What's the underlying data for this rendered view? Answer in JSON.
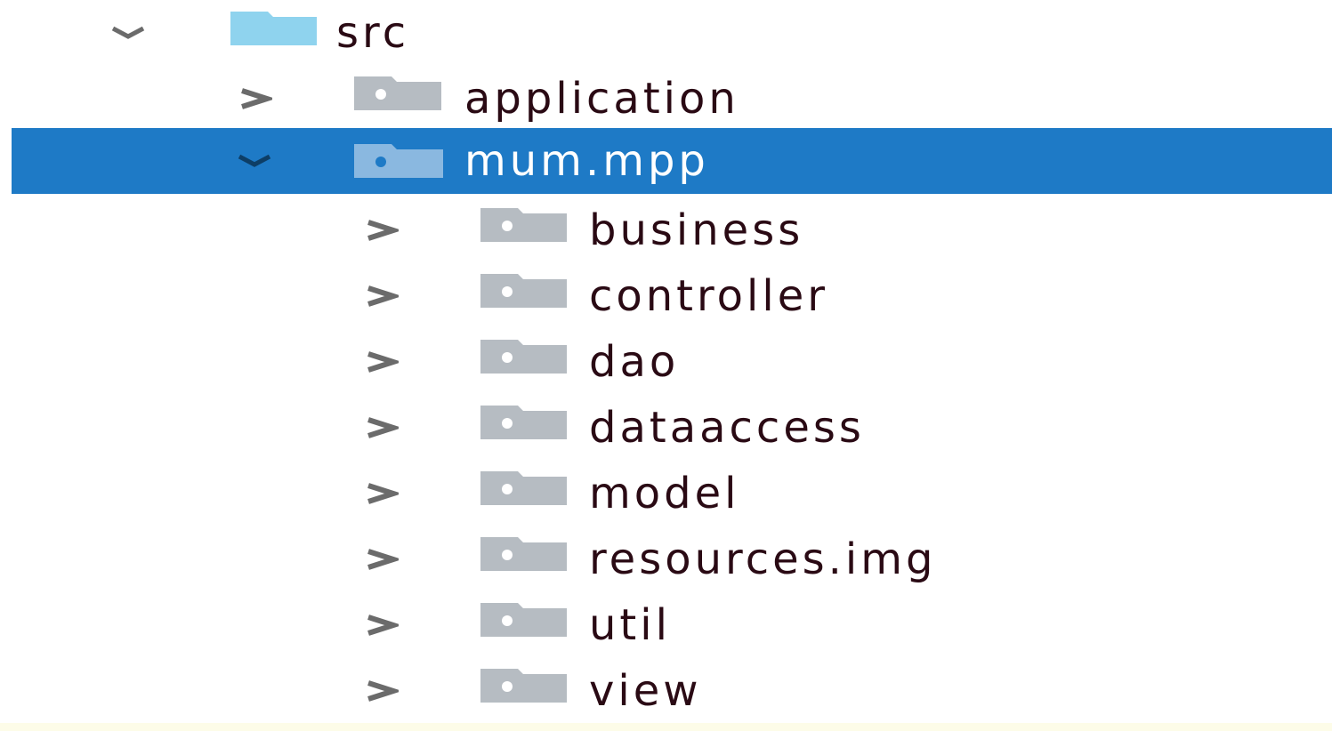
{
  "tree": {
    "root": {
      "label": "src",
      "expanded": true,
      "icon": "source-folder-icon",
      "color": "#8fd3ee"
    },
    "children": [
      {
        "label": "application",
        "expanded": false,
        "icon": "package-icon"
      },
      {
        "label": "mum.mpp",
        "expanded": true,
        "selected": true,
        "icon": "package-icon",
        "children": [
          {
            "label": "business",
            "expanded": false,
            "icon": "package-icon"
          },
          {
            "label": "controller",
            "expanded": false,
            "icon": "package-icon"
          },
          {
            "label": "dao",
            "expanded": false,
            "icon": "package-icon"
          },
          {
            "label": "dataaccess",
            "expanded": false,
            "icon": "package-icon"
          },
          {
            "label": "model",
            "expanded": false,
            "icon": "package-icon"
          },
          {
            "label": "resources.img",
            "expanded": false,
            "icon": "package-icon"
          },
          {
            "label": "util",
            "expanded": false,
            "icon": "package-icon"
          },
          {
            "label": "view",
            "expanded": false,
            "icon": "package-icon"
          }
        ]
      }
    ]
  },
  "colors": {
    "selection": "#1e7ac6",
    "text": "#2a0a14",
    "folder": "#b6bcc2",
    "chevron": "#6b6b6b"
  }
}
